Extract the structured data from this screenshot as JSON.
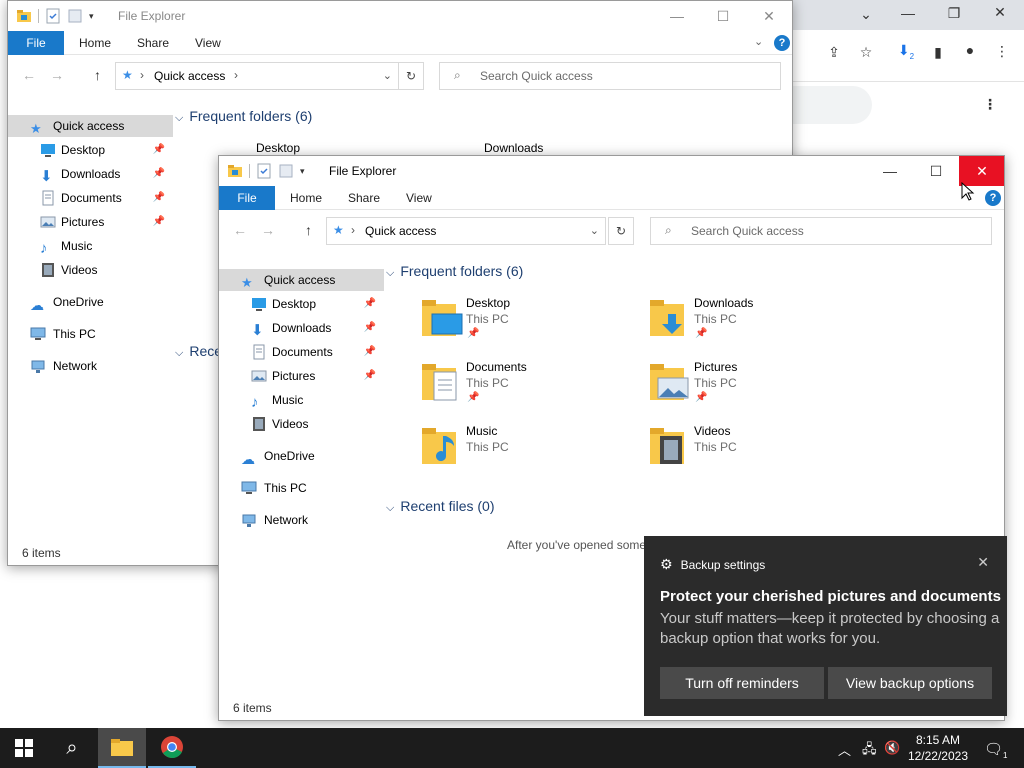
{
  "colors": {
    "accent": "#1979ca",
    "close": "#e81123",
    "folder": "#f8c84a",
    "taskbar": "#1c1c1c",
    "toast": "#2b2b2b"
  },
  "back_window": {
    "title": "File Explorer",
    "tabs": {
      "file": "File",
      "home": "Home",
      "share": "Share",
      "view": "View"
    },
    "address": "Quick access",
    "search_placeholder": "Search Quick access",
    "nav": [
      {
        "label": "Quick access",
        "icon": "star-icon"
      },
      {
        "label": "Desktop",
        "icon": "desktop-icon"
      },
      {
        "label": "Downloads",
        "icon": "download-icon"
      },
      {
        "label": "Documents",
        "icon": "document-icon"
      },
      {
        "label": "Pictures",
        "icon": "pictures-icon"
      },
      {
        "label": "Music",
        "icon": "music-icon"
      },
      {
        "label": "Videos",
        "icon": "video-icon"
      },
      {
        "label": "OneDrive",
        "icon": "cloud-icon"
      },
      {
        "label": "This PC",
        "icon": "computer-icon"
      },
      {
        "label": "Network",
        "icon": "network-icon"
      }
    ],
    "frequent_header": "Frequent folders (6)",
    "recent_header": "Rece",
    "folder_names": [
      "Desktop",
      "Downloads"
    ],
    "status": "6 items"
  },
  "front_window": {
    "title": "File Explorer",
    "tabs": {
      "file": "File",
      "home": "Home",
      "share": "Share",
      "view": "View"
    },
    "address": "Quick access",
    "search_placeholder": "Search Quick access",
    "nav": [
      {
        "label": "Quick access",
        "icon": "star-icon"
      },
      {
        "label": "Desktop",
        "icon": "desktop-icon"
      },
      {
        "label": "Downloads",
        "icon": "download-icon"
      },
      {
        "label": "Documents",
        "icon": "document-icon"
      },
      {
        "label": "Pictures",
        "icon": "pictures-icon"
      },
      {
        "label": "Music",
        "icon": "music-icon"
      },
      {
        "label": "Videos",
        "icon": "video-icon"
      },
      {
        "label": "OneDrive",
        "icon": "cloud-icon"
      },
      {
        "label": "This PC",
        "icon": "computer-icon"
      },
      {
        "label": "Network",
        "icon": "network-icon"
      }
    ],
    "frequent_header": "Frequent folders (6)",
    "folders": [
      {
        "name": "Desktop",
        "location": "This PC",
        "pinned": true
      },
      {
        "name": "Downloads",
        "location": "This PC",
        "pinned": true
      },
      {
        "name": "Documents",
        "location": "This PC",
        "pinned": true
      },
      {
        "name": "Pictures",
        "location": "This PC",
        "pinned": true
      },
      {
        "name": "Music",
        "location": "This PC",
        "pinned": false
      },
      {
        "name": "Videos",
        "location": "This PC",
        "pinned": false
      }
    ],
    "recent_header": "Recent files (0)",
    "recent_empty": "After you've opened some",
    "status": "6 items"
  },
  "toast": {
    "app": "Backup settings",
    "title": "Protect your cherished pictures and documents",
    "body": "Your stuff matters—keep it protected by choosing a backup option that works for you.",
    "btn_off": "Turn off reminders",
    "btn_view": "View backup options"
  },
  "taskbar": {
    "time": "8:15 AM",
    "date": "12/22/2023",
    "notifications": "1"
  },
  "chrome": {
    "download_badge": "2"
  }
}
